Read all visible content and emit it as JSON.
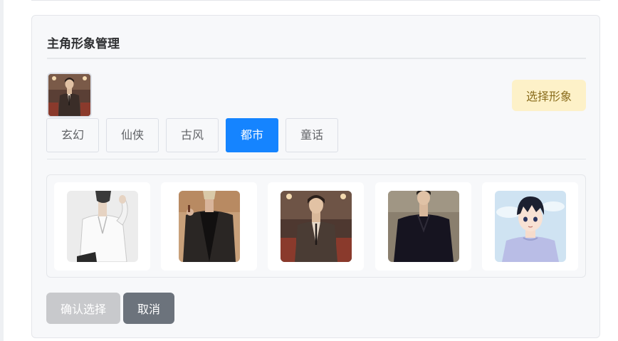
{
  "panel": {
    "title": "主角形象管理",
    "select_button_label": "选择形象"
  },
  "current_character": {
    "icon": "character-avatar-icon"
  },
  "tabs": [
    {
      "label": "玄幻",
      "active": false
    },
    {
      "label": "仙侠",
      "active": false
    },
    {
      "label": "古风",
      "active": false
    },
    {
      "label": "都市",
      "active": true
    },
    {
      "label": "童话",
      "active": false
    }
  ],
  "characters": [
    {
      "icon": "white-shirt-man-icon"
    },
    {
      "icon": "black-suit-man-icon"
    },
    {
      "icon": "brown-suit-man-icon"
    },
    {
      "icon": "black-shirt-man-icon"
    },
    {
      "icon": "anime-boy-icon"
    }
  ],
  "actions": {
    "confirm_label": "确认选择",
    "cancel_label": "取消"
  },
  "colors": {
    "accent": "#1584ff",
    "select_button_bg": "#fdf1c8",
    "confirm_disabled_bg": "#c8c9cc",
    "cancel_bg": "#6c737c"
  }
}
